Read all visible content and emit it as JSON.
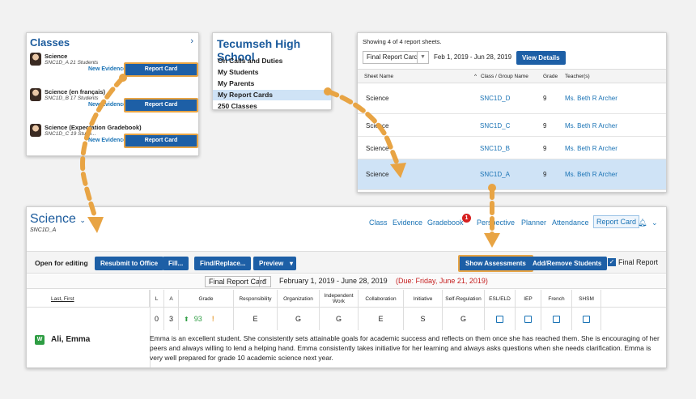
{
  "classes_panel": {
    "title": "Classes",
    "items": [
      {
        "name": "Science",
        "sub": "SNC1D_A  21 Students",
        "new_evidence": "New Evidence",
        "report_card": "Report Card"
      },
      {
        "name": "Science (en français)",
        "sub": "SNC1D_B  17 Students",
        "new_evidence": "New Evidence",
        "report_card": "Report Card"
      },
      {
        "name": "Science (Expectation Gradebook)",
        "sub": "SNC1D_C  19 Stude...",
        "new_evidence": "New Evidence",
        "report_card": "Report Card"
      }
    ]
  },
  "school_panel": {
    "title": "Tecumseh High School",
    "items": [
      "On Calls and Duties",
      "My Students",
      "My Parents",
      "My Report Cards",
      "250 Classes"
    ],
    "selected_index": 3
  },
  "sheets_panel": {
    "header": "Showing 4 of 4 report sheets.",
    "select_value": "Final Report Card",
    "date_range": "Feb 1, 2019 - Jun 28, 2019",
    "view_details": "View Details",
    "columns": [
      "Sheet Name",
      "Class / Group Name",
      "Grade",
      "Teacher(s)"
    ],
    "rows": [
      {
        "sheet": "Science",
        "class": "SNC1D_D",
        "grade": "9",
        "teacher": "Ms. Beth R Archer"
      },
      {
        "sheet": "Science",
        "class": "SNC1D_C",
        "grade": "9",
        "teacher": "Ms. Beth R Archer"
      },
      {
        "sheet": "Science",
        "class": "SNC1D_B",
        "grade": "9",
        "teacher": "Ms. Beth R Archer"
      },
      {
        "sheet": "Science",
        "class": "SNC1D_A",
        "grade": "9",
        "teacher": "Ms. Beth R Archer"
      }
    ],
    "selected_index": 3
  },
  "main": {
    "title": "Science",
    "subtitle": "SNC1D_A",
    "nav": [
      "Class",
      "Evidence",
      "Gradebook",
      "Perspective",
      "Planner",
      "Attendance",
      "Report Card"
    ],
    "badge_count": "1",
    "toolbar": {
      "status": "Open for editing",
      "resubmit": "Resubmit to Office",
      "fill": "Fill...",
      "find_replace": "Find/Replace...",
      "preview": "Preview",
      "show_assessments": "Show Assessments",
      "add_remove": "Add/Remove Students",
      "final_report": "Final Report"
    },
    "datebar": {
      "select_value": "Final Report Card",
      "range": "February 1, 2019 - June 28, 2019",
      "due": "(Due: Friday, June 21, 2019)"
    },
    "grid_columns": [
      "Last, First",
      "L",
      "A",
      "Grade",
      "Responsibility",
      "Organization",
      "Independent Work",
      "Collaboration",
      "Initiative",
      "Self-Regulation",
      "ESL/ELD",
      "IEP",
      "French",
      "SHSM"
    ],
    "student": {
      "name": "Ali, Emma",
      "badge": "W",
      "L": "0",
      "A": "3",
      "grade": "93",
      "responsibility": "E",
      "organization": "G",
      "independent_work": "G",
      "collaboration": "E",
      "initiative": "S",
      "self_regulation": "G",
      "comment": "Emma is an excellent student. She consistently sets attainable goals for academic success and reflects on them once she has reached them. She is encouraging of her peers and always willing to lend a helping hand. Emma consistently takes initiative for her learning and always asks questions when she needs clarification. Emma is very well prepared for grade 10 academic science next year."
    }
  },
  "colors": {
    "accent": "#1d5fa6",
    "highlight": "#e8a444",
    "selected": "#cfe3f6"
  }
}
